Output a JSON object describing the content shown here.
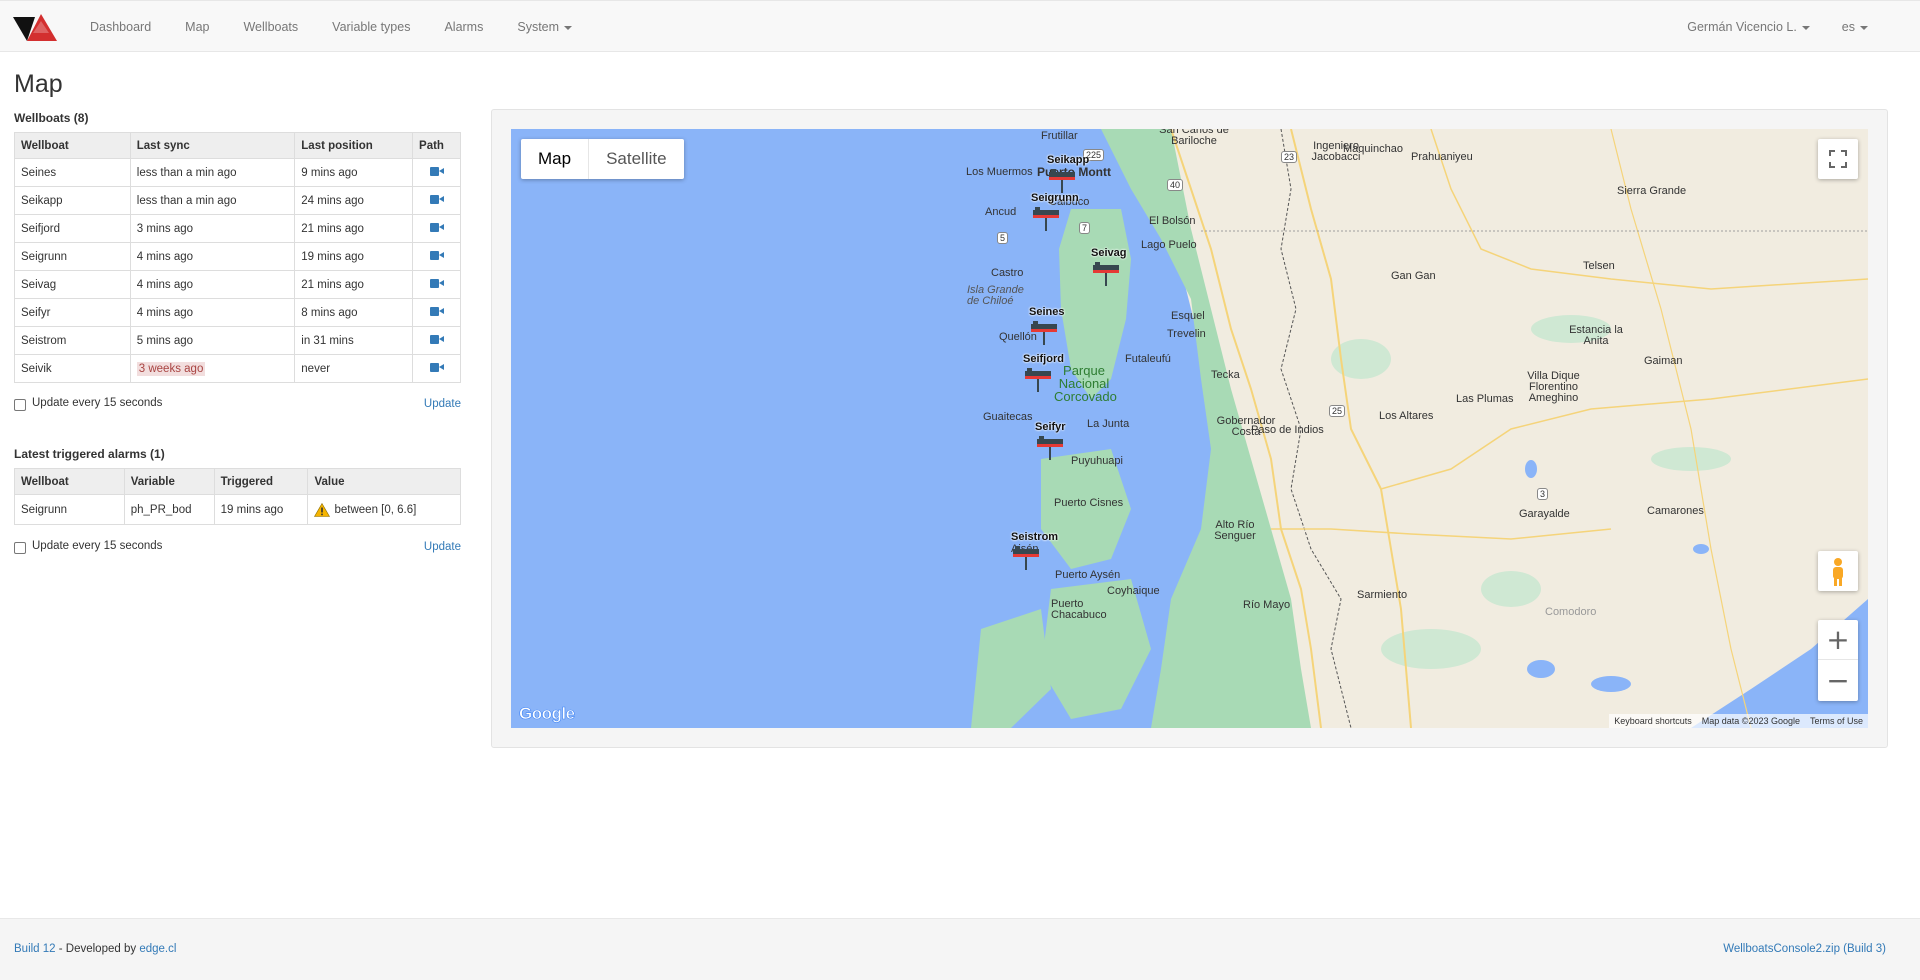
{
  "nav": {
    "items": [
      "Dashboard",
      "Map",
      "Wellboats",
      "Variable types",
      "Alarms",
      "System"
    ],
    "user": "Germán Vicencio L.",
    "lang": "es"
  },
  "page_title": "Map",
  "wellboats": {
    "title": "Wellboats (8)",
    "columns": [
      "Wellboat",
      "Last sync",
      "Last position",
      "Path"
    ],
    "rows": [
      {
        "name": "Seines",
        "sync": "less than a min ago",
        "position": "9 mins ago"
      },
      {
        "name": "Seikapp",
        "sync": "less than a min ago",
        "position": "24 mins ago"
      },
      {
        "name": "Seifjord",
        "sync": "3 mins ago",
        "position": "21 mins ago"
      },
      {
        "name": "Seigrunn",
        "sync": "4 mins ago",
        "position": "19 mins ago"
      },
      {
        "name": "Seivag",
        "sync": "4 mins ago",
        "position": "21 mins ago"
      },
      {
        "name": "Seifyr",
        "sync": "4 mins ago",
        "position": "8 mins ago"
      },
      {
        "name": "Seistrom",
        "sync": "5 mins ago",
        "position": "in 31 mins"
      },
      {
        "name": "Seivik",
        "sync": "3 weeks ago",
        "position": "never"
      }
    ],
    "auto_update_label": "Update every 15 seconds",
    "update_label": "Update"
  },
  "alarms": {
    "title": "Latest triggered alarms (1)",
    "columns": [
      "Wellboat",
      "Variable",
      "Triggered",
      "Value"
    ],
    "rows": [
      {
        "wellboat": "Seigrunn",
        "variable": "ph_PR_bod",
        "triggered": "19 mins ago",
        "value": "between [0, 6.6]"
      }
    ],
    "auto_update_label": "Update every 15 seconds",
    "update_label": "Update"
  },
  "map": {
    "type_map": "Map",
    "type_satellite": "Satellite",
    "places": [
      "Frutillar",
      "Los Muermos",
      "Puerto Montt",
      "Ancud",
      "Calbuco",
      "Castro",
      "Isla Grande de Chiloé",
      "Quellón",
      "Guaitecas",
      "Puyuhuapi",
      "Puerto Cisnes",
      "Aisén",
      "Puerto Aysén",
      "Coyhaique",
      "Puerto Chacabuco",
      "El Bolsón",
      "Lago Puelo",
      "Esquel",
      "Trevelin",
      "Futaleufú",
      "La Junta",
      "Parque Nacional Corcovado",
      "Tecka",
      "Gobernador Costa",
      "Paso de Indios",
      "Alto Río Senguer",
      "Río Mayo",
      "Sarmiento",
      "Los Altares",
      "Las Plumas",
      "Gan Gan",
      "Telsen",
      "Estancia la Anita",
      "Villa Dique Florentino Ameghino",
      "Gaiman",
      "Garayalde",
      "Camarones",
      "Sierra Grande",
      "Maquinchao",
      "Prahuaniyeu",
      "Ingeniero Jacobacci",
      "San Carlos de Bariloche",
      "Comodoro"
    ],
    "route_numbers": [
      "225",
      "5",
      "7",
      "40",
      "23",
      "25",
      "3"
    ],
    "boats": [
      "Seikapp",
      "Seigrunn",
      "Seivag",
      "Seines",
      "Seifjord",
      "Seifyr",
      "Seistrom"
    ],
    "footer": [
      "Keyboard shortcuts",
      "Map data ©2023 Google",
      "Terms of Use"
    ],
    "logo": "Google",
    "zoom_in": "+",
    "zoom_out": "−"
  },
  "footer": {
    "build": "Build 12",
    "developed_by": " - Developed by ",
    "company": "edge.cl",
    "right": "WellboatsConsole2.zip (Build 3)"
  },
  "colors": {
    "water": "#8ab4f8",
    "land": "#f1ece0",
    "forest": "#a8dab5",
    "link": "#337ab7"
  }
}
